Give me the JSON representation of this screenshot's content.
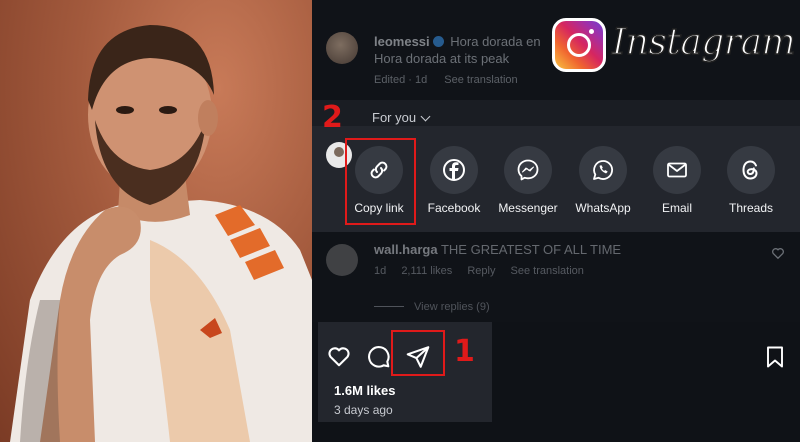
{
  "post": {
    "username": "leomessi",
    "caption_line1": "Hora dorada en",
    "caption_line2": "Hora dorada at its peak",
    "edited_label": "Edited · 1d",
    "see_translation": "See translation"
  },
  "share_sheet": {
    "header": "For you",
    "options": [
      {
        "label": "Copy link",
        "icon": "link-icon"
      },
      {
        "label": "Facebook",
        "icon": "facebook-icon"
      },
      {
        "label": "Messenger",
        "icon": "messenger-icon"
      },
      {
        "label": "WhatsApp",
        "icon": "whatsapp-icon"
      },
      {
        "label": "Email",
        "icon": "email-icon"
      },
      {
        "label": "Threads",
        "icon": "threads-icon"
      }
    ]
  },
  "comment": {
    "username": "wall.harga",
    "text": "THE GREATEST OF ALL TIME",
    "time": "1d",
    "likes": "2,111 likes",
    "reply": "Reply",
    "see_translation": "See translation",
    "view_replies": "View replies (9)"
  },
  "actions": {
    "likes": "1.6M likes",
    "posted": "3 days ago"
  },
  "annotations": {
    "step_share": "1",
    "step_copy": "2",
    "highlight_color": "#e01a1a"
  },
  "badge": {
    "wordmark": "Instagram"
  },
  "colors": {
    "panel_bg": "#0f1217",
    "sheet_bg": "#23262d",
    "icon_circle": "#363a42"
  }
}
